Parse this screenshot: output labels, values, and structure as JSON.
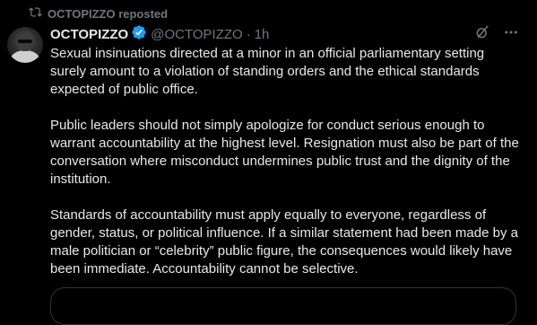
{
  "repost": {
    "icon": "repost-icon",
    "text": "OCTOPIZZO reposted"
  },
  "post": {
    "author": {
      "display_name": "OCTOPIZZO",
      "handle": "@OCTOPIZZO",
      "verified": true,
      "verified_color": "#1d9bf0"
    },
    "separator": "·",
    "time": "1h",
    "actions": [
      "grok-icon",
      "more-icon"
    ],
    "paragraphs": [
      "Sexual insinuations directed at a minor in an official parliamentary setting surely amount to a violation of standing orders and the ethical standards expected of public office.",
      "Public leaders should not simply apologize for conduct serious enough to warrant accountability at the highest level. Resignation must also be part of the conversation where misconduct undermines public trust and the dignity of the institution.",
      "Standards of accountability must apply equally to everyone, regardless of gender, status, or political influence. If a similar statement had been made by a male politician or “celebrity” public figure, the consequences would likely have been immediate. Accountability cannot be selective."
    ]
  },
  "colors": {
    "background": "#000000",
    "text_primary": "#e7e9ea",
    "text_secondary": "#71767b",
    "border": "#2f3336"
  }
}
